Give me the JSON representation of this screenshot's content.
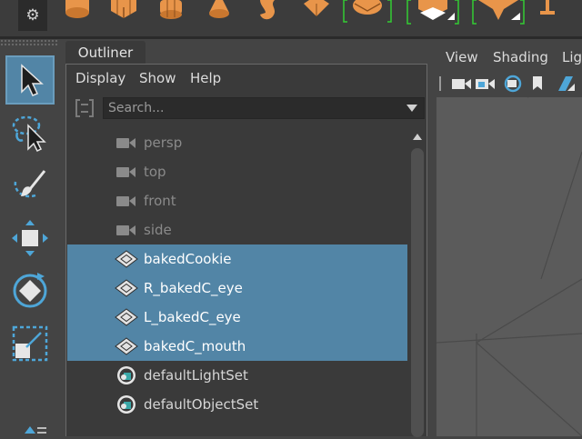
{
  "shelf": {
    "settings_icon": "gear-icon",
    "icons": [
      "cylinder-icon",
      "cube-icon",
      "torus-ring-icon",
      "cone-icon",
      "twist-icon",
      "diamond-icon",
      "sphere-bracket-icon",
      "cube-bracket-icon",
      "plane-bracket-icon",
      "pin-icon"
    ],
    "colors": {
      "icon_orange": "#e8954a",
      "bracket_green": "#33cc33"
    }
  },
  "toolbox": {
    "tools": [
      {
        "name": "select-tool",
        "icon": "arrow-cursor-icon",
        "active": true
      },
      {
        "name": "lasso-tool",
        "icon": "lasso-icon",
        "active": false
      },
      {
        "name": "paint-select-tool",
        "icon": "brush-icon",
        "active": false
      },
      {
        "name": "move-tool",
        "icon": "move-arrows-icon",
        "active": false
      },
      {
        "name": "rotate-tool",
        "icon": "rotate-icon",
        "active": false
      },
      {
        "name": "scale-tool",
        "icon": "scale-icon",
        "active": false
      }
    ],
    "colors": {
      "active_bg": "#5285a6",
      "icon_blue": "#4ea6d8"
    }
  },
  "outliner": {
    "tab_label": "Outliner",
    "menu": [
      "Display",
      "Show",
      "Help"
    ],
    "search": {
      "placeholder": "Search...",
      "value": ""
    },
    "items": [
      {
        "label": "persp",
        "icon": "camera-icon",
        "selected": false,
        "dim": true
      },
      {
        "label": "top",
        "icon": "camera-icon",
        "selected": false,
        "dim": true
      },
      {
        "label": "front",
        "icon": "camera-icon",
        "selected": false,
        "dim": true
      },
      {
        "label": "side",
        "icon": "camera-icon",
        "selected": false,
        "dim": true
      },
      {
        "label": "bakedCookie",
        "icon": "mesh-icon",
        "selected": true,
        "dim": false
      },
      {
        "label": "R_bakedC_eye",
        "icon": "mesh-icon",
        "selected": true,
        "dim": false
      },
      {
        "label": "L_bakedC_eye",
        "icon": "mesh-icon",
        "selected": true,
        "dim": false
      },
      {
        "label": "bakedC_mouth",
        "icon": "mesh-icon",
        "selected": true,
        "dim": false
      },
      {
        "label": "defaultLightSet",
        "icon": "set-icon",
        "selected": false,
        "dim": false
      },
      {
        "label": "defaultObjectSet",
        "icon": "set-icon",
        "selected": false,
        "dim": false
      }
    ],
    "colors": {
      "selection": "#5285a6",
      "panel_bg": "#3a3a3a"
    }
  },
  "viewport": {
    "menu": [
      "View",
      "Shading",
      "Lig"
    ],
    "toolbar_icons": [
      "camera-icon",
      "camera-lock-icon",
      "camera-attributes-icon",
      "bookmark-icon",
      "image-plane-icon"
    ]
  }
}
